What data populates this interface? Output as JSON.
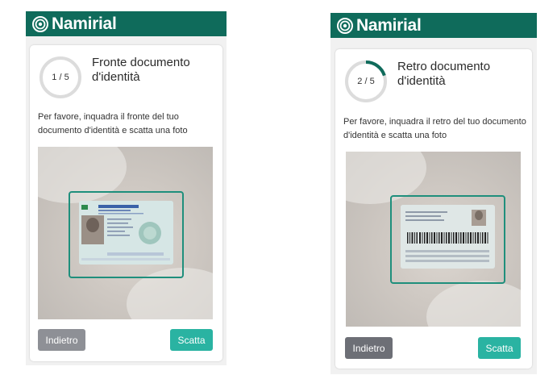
{
  "brand": {
    "name": "Namirial",
    "icon": "namirial-logo-icon",
    "color": "#0f6b5b"
  },
  "screens": [
    {
      "step_label": "1 / 5",
      "progress": 0.0,
      "title_line1": "Fronte documento",
      "title_line2": "d'identità",
      "instruction": "Per favore, inquadra il fronte del tuo documento d'identità e scatta una foto",
      "back_label": "Indietro",
      "shoot_label": "Scatta"
    },
    {
      "step_label": "2 / 5",
      "progress": 0.2,
      "title_line1": "Retro documento",
      "title_line2": "d'identità",
      "instruction": "Per favore, inquadra il retro del tuo documento d'identità e scatta una foto",
      "back_label": "Indietro",
      "shoot_label": "Scatta"
    }
  ],
  "colors": {
    "accent": "#2ab3a2",
    "frame": "#1f8f7c",
    "progress_track": "#dcdcdc",
    "progress_fill": "#0f6b5b"
  }
}
